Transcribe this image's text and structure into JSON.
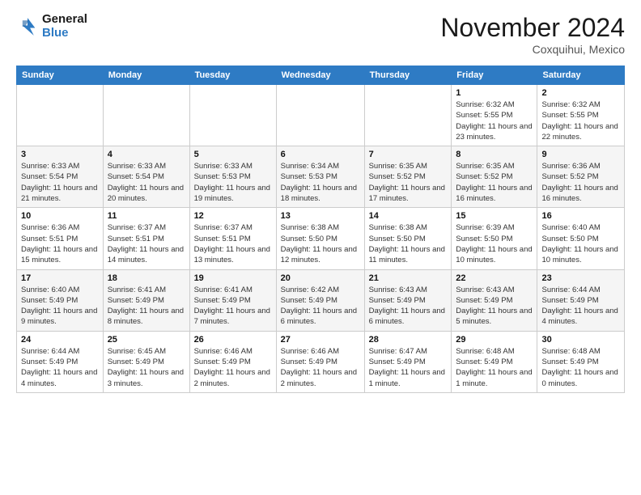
{
  "header": {
    "logo_line1": "General",
    "logo_line2": "Blue",
    "month": "November 2024",
    "location": "Coxquihui, Mexico"
  },
  "days_of_week": [
    "Sunday",
    "Monday",
    "Tuesday",
    "Wednesday",
    "Thursday",
    "Friday",
    "Saturday"
  ],
  "weeks": [
    [
      {
        "day": "",
        "info": ""
      },
      {
        "day": "",
        "info": ""
      },
      {
        "day": "",
        "info": ""
      },
      {
        "day": "",
        "info": ""
      },
      {
        "day": "",
        "info": ""
      },
      {
        "day": "1",
        "info": "Sunrise: 6:32 AM\nSunset: 5:55 PM\nDaylight: 11 hours and 23 minutes."
      },
      {
        "day": "2",
        "info": "Sunrise: 6:32 AM\nSunset: 5:55 PM\nDaylight: 11 hours and 22 minutes."
      }
    ],
    [
      {
        "day": "3",
        "info": "Sunrise: 6:33 AM\nSunset: 5:54 PM\nDaylight: 11 hours and 21 minutes."
      },
      {
        "day": "4",
        "info": "Sunrise: 6:33 AM\nSunset: 5:54 PM\nDaylight: 11 hours and 20 minutes."
      },
      {
        "day": "5",
        "info": "Sunrise: 6:33 AM\nSunset: 5:53 PM\nDaylight: 11 hours and 19 minutes."
      },
      {
        "day": "6",
        "info": "Sunrise: 6:34 AM\nSunset: 5:53 PM\nDaylight: 11 hours and 18 minutes."
      },
      {
        "day": "7",
        "info": "Sunrise: 6:35 AM\nSunset: 5:52 PM\nDaylight: 11 hours and 17 minutes."
      },
      {
        "day": "8",
        "info": "Sunrise: 6:35 AM\nSunset: 5:52 PM\nDaylight: 11 hours and 16 minutes."
      },
      {
        "day": "9",
        "info": "Sunrise: 6:36 AM\nSunset: 5:52 PM\nDaylight: 11 hours and 16 minutes."
      }
    ],
    [
      {
        "day": "10",
        "info": "Sunrise: 6:36 AM\nSunset: 5:51 PM\nDaylight: 11 hours and 15 minutes."
      },
      {
        "day": "11",
        "info": "Sunrise: 6:37 AM\nSunset: 5:51 PM\nDaylight: 11 hours and 14 minutes."
      },
      {
        "day": "12",
        "info": "Sunrise: 6:37 AM\nSunset: 5:51 PM\nDaylight: 11 hours and 13 minutes."
      },
      {
        "day": "13",
        "info": "Sunrise: 6:38 AM\nSunset: 5:50 PM\nDaylight: 11 hours and 12 minutes."
      },
      {
        "day": "14",
        "info": "Sunrise: 6:38 AM\nSunset: 5:50 PM\nDaylight: 11 hours and 11 minutes."
      },
      {
        "day": "15",
        "info": "Sunrise: 6:39 AM\nSunset: 5:50 PM\nDaylight: 11 hours and 10 minutes."
      },
      {
        "day": "16",
        "info": "Sunrise: 6:40 AM\nSunset: 5:50 PM\nDaylight: 11 hours and 10 minutes."
      }
    ],
    [
      {
        "day": "17",
        "info": "Sunrise: 6:40 AM\nSunset: 5:49 PM\nDaylight: 11 hours and 9 minutes."
      },
      {
        "day": "18",
        "info": "Sunrise: 6:41 AM\nSunset: 5:49 PM\nDaylight: 11 hours and 8 minutes."
      },
      {
        "day": "19",
        "info": "Sunrise: 6:41 AM\nSunset: 5:49 PM\nDaylight: 11 hours and 7 minutes."
      },
      {
        "day": "20",
        "info": "Sunrise: 6:42 AM\nSunset: 5:49 PM\nDaylight: 11 hours and 6 minutes."
      },
      {
        "day": "21",
        "info": "Sunrise: 6:43 AM\nSunset: 5:49 PM\nDaylight: 11 hours and 6 minutes."
      },
      {
        "day": "22",
        "info": "Sunrise: 6:43 AM\nSunset: 5:49 PM\nDaylight: 11 hours and 5 minutes."
      },
      {
        "day": "23",
        "info": "Sunrise: 6:44 AM\nSunset: 5:49 PM\nDaylight: 11 hours and 4 minutes."
      }
    ],
    [
      {
        "day": "24",
        "info": "Sunrise: 6:44 AM\nSunset: 5:49 PM\nDaylight: 11 hours and 4 minutes."
      },
      {
        "day": "25",
        "info": "Sunrise: 6:45 AM\nSunset: 5:49 PM\nDaylight: 11 hours and 3 minutes."
      },
      {
        "day": "26",
        "info": "Sunrise: 6:46 AM\nSunset: 5:49 PM\nDaylight: 11 hours and 2 minutes."
      },
      {
        "day": "27",
        "info": "Sunrise: 6:46 AM\nSunset: 5:49 PM\nDaylight: 11 hours and 2 minutes."
      },
      {
        "day": "28",
        "info": "Sunrise: 6:47 AM\nSunset: 5:49 PM\nDaylight: 11 hours and 1 minute."
      },
      {
        "day": "29",
        "info": "Sunrise: 6:48 AM\nSunset: 5:49 PM\nDaylight: 11 hours and 1 minute."
      },
      {
        "day": "30",
        "info": "Sunrise: 6:48 AM\nSunset: 5:49 PM\nDaylight: 11 hours and 0 minutes."
      }
    ]
  ]
}
